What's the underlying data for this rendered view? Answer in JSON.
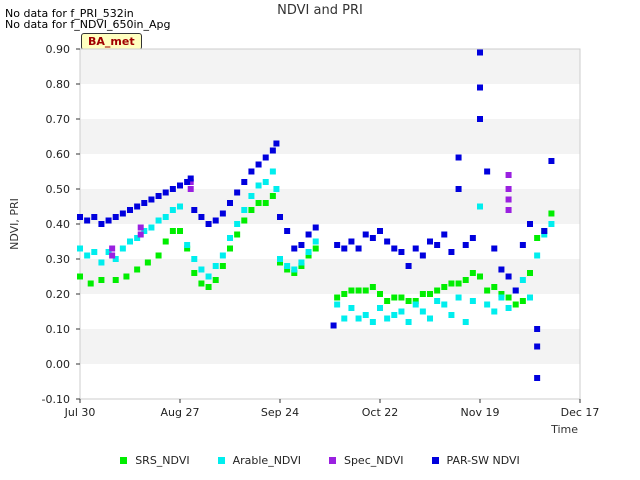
{
  "chart_data": {
    "type": "scatter",
    "title": "NDVI and PRI",
    "xlabel": "Time",
    "ylabel": "NDVI, PRI",
    "notes": [
      "No data for f_PRI_532in",
      "No data for f_NDVI_650in_Apg"
    ],
    "site_label": "BA_met",
    "ylim": [
      -0.1,
      0.9
    ],
    "y_ticks": [
      "-0.10",
      "0.00",
      "0.10",
      "0.20",
      "0.30",
      "0.40",
      "0.50",
      "0.60",
      "0.70",
      "0.80",
      "0.90"
    ],
    "x_ticks": [
      "Jul 30",
      "Aug 27",
      "Sep 24",
      "Oct 22",
      "Nov 19",
      "Dec 17"
    ],
    "grid": "horizontal bands",
    "legend_position": "bottom",
    "series": [
      {
        "name": "SRS_NDVI",
        "color": "#00ee00",
        "points": [
          [
            0,
            0.25
          ],
          [
            3,
            0.23
          ],
          [
            6,
            0.24
          ],
          [
            10,
            0.24
          ],
          [
            13,
            0.25
          ],
          [
            16,
            0.27
          ],
          [
            19,
            0.29
          ],
          [
            22,
            0.31
          ],
          [
            24,
            0.35
          ],
          [
            26,
            0.38
          ],
          [
            28,
            0.38
          ],
          [
            30,
            0.33
          ],
          [
            32,
            0.26
          ],
          [
            34,
            0.23
          ],
          [
            36,
            0.22
          ],
          [
            38,
            0.24
          ],
          [
            40,
            0.28
          ],
          [
            42,
            0.33
          ],
          [
            44,
            0.37
          ],
          [
            46,
            0.41
          ],
          [
            48,
            0.44
          ],
          [
            50,
            0.46
          ],
          [
            52,
            0.46
          ],
          [
            54,
            0.48
          ],
          [
            56,
            0.29
          ],
          [
            58,
            0.27
          ],
          [
            60,
            0.26
          ],
          [
            62,
            0.28
          ],
          [
            64,
            0.31
          ],
          [
            66,
            0.33
          ],
          [
            72,
            0.19
          ],
          [
            74,
            0.2
          ],
          [
            76,
            0.21
          ],
          [
            78,
            0.21
          ],
          [
            80,
            0.21
          ],
          [
            82,
            0.22
          ],
          [
            84,
            0.2
          ],
          [
            86,
            0.18
          ],
          [
            88,
            0.19
          ],
          [
            90,
            0.19
          ],
          [
            92,
            0.18
          ],
          [
            94,
            0.18
          ],
          [
            96,
            0.2
          ],
          [
            98,
            0.2
          ],
          [
            100,
            0.21
          ],
          [
            102,
            0.22
          ],
          [
            104,
            0.23
          ],
          [
            106,
            0.23
          ],
          [
            108,
            0.24
          ],
          [
            110,
            0.26
          ],
          [
            112,
            0.25
          ],
          [
            114,
            0.21
          ],
          [
            116,
            0.22
          ],
          [
            118,
            0.2
          ],
          [
            120,
            0.19
          ],
          [
            122,
            0.17
          ],
          [
            124,
            0.18
          ],
          [
            126,
            0.26
          ],
          [
            128,
            0.36
          ],
          [
            130,
            0.38
          ],
          [
            132,
            0.43
          ]
        ]
      },
      {
        "name": "Arable_NDVI",
        "color": "#00eeee",
        "points": [
          [
            0,
            0.33
          ],
          [
            2,
            0.31
          ],
          [
            4,
            0.32
          ],
          [
            6,
            0.29
          ],
          [
            8,
            0.32
          ],
          [
            10,
            0.3
          ],
          [
            12,
            0.33
          ],
          [
            14,
            0.35
          ],
          [
            16,
            0.36
          ],
          [
            18,
            0.38
          ],
          [
            20,
            0.39
          ],
          [
            22,
            0.41
          ],
          [
            24,
            0.42
          ],
          [
            26,
            0.44
          ],
          [
            28,
            0.45
          ],
          [
            30,
            0.34
          ],
          [
            32,
            0.3
          ],
          [
            34,
            0.27
          ],
          [
            36,
            0.25
          ],
          [
            38,
            0.28
          ],
          [
            40,
            0.31
          ],
          [
            42,
            0.36
          ],
          [
            44,
            0.4
          ],
          [
            46,
            0.44
          ],
          [
            48,
            0.48
          ],
          [
            50,
            0.51
          ],
          [
            52,
            0.52
          ],
          [
            54,
            0.55
          ],
          [
            55,
            0.5
          ],
          [
            56,
            0.3
          ],
          [
            58,
            0.28
          ],
          [
            60,
            0.27
          ],
          [
            62,
            0.29
          ],
          [
            64,
            0.32
          ],
          [
            66,
            0.35
          ],
          [
            72,
            0.17
          ],
          [
            74,
            0.13
          ],
          [
            76,
            0.16
          ],
          [
            78,
            0.13
          ],
          [
            80,
            0.14
          ],
          [
            82,
            0.12
          ],
          [
            84,
            0.16
          ],
          [
            86,
            0.13
          ],
          [
            88,
            0.14
          ],
          [
            90,
            0.15
          ],
          [
            92,
            0.12
          ],
          [
            94,
            0.17
          ],
          [
            96,
            0.15
          ],
          [
            98,
            0.13
          ],
          [
            100,
            0.18
          ],
          [
            102,
            0.17
          ],
          [
            104,
            0.14
          ],
          [
            106,
            0.19
          ],
          [
            108,
            0.12
          ],
          [
            110,
            0.18
          ],
          [
            112,
            0.45
          ],
          [
            114,
            0.17
          ],
          [
            116,
            0.15
          ],
          [
            118,
            0.19
          ],
          [
            120,
            0.16
          ],
          [
            122,
            0.21
          ],
          [
            124,
            0.24
          ],
          [
            126,
            0.19
          ],
          [
            128,
            0.31
          ],
          [
            130,
            0.37
          ],
          [
            132,
            0.4
          ]
        ]
      },
      {
        "name": "Spec_NDVI",
        "color": "#9a20e0",
        "points": [
          [
            9,
            0.31
          ],
          [
            9,
            0.33
          ],
          [
            17,
            0.37
          ],
          [
            17,
            0.39
          ],
          [
            31,
            0.5
          ],
          [
            31,
            0.52
          ],
          [
            120,
            0.54
          ],
          [
            120,
            0.5
          ],
          [
            120,
            0.47
          ],
          [
            120,
            0.44
          ]
        ]
      },
      {
        "name": "PAR-SW NDVI",
        "color": "#0000dd",
        "points": [
          [
            0,
            0.42
          ],
          [
            2,
            0.41
          ],
          [
            4,
            0.42
          ],
          [
            6,
            0.4
          ],
          [
            8,
            0.41
          ],
          [
            10,
            0.42
          ],
          [
            12,
            0.43
          ],
          [
            14,
            0.44
          ],
          [
            16,
            0.45
          ],
          [
            18,
            0.46
          ],
          [
            20,
            0.47
          ],
          [
            22,
            0.48
          ],
          [
            24,
            0.49
          ],
          [
            26,
            0.5
          ],
          [
            28,
            0.51
          ],
          [
            30,
            0.52
          ],
          [
            31,
            0.53
          ],
          [
            32,
            0.44
          ],
          [
            34,
            0.42
          ],
          [
            36,
            0.4
          ],
          [
            38,
            0.41
          ],
          [
            40,
            0.43
          ],
          [
            42,
            0.46
          ],
          [
            44,
            0.49
          ],
          [
            46,
            0.52
          ],
          [
            48,
            0.55
          ],
          [
            50,
            0.57
          ],
          [
            52,
            0.59
          ],
          [
            54,
            0.61
          ],
          [
            55,
            0.63
          ],
          [
            56,
            0.42
          ],
          [
            58,
            0.38
          ],
          [
            60,
            0.33
          ],
          [
            62,
            0.34
          ],
          [
            64,
            0.37
          ],
          [
            66,
            0.39
          ],
          [
            71,
            0.11
          ],
          [
            72,
            0.34
          ],
          [
            74,
            0.33
          ],
          [
            76,
            0.35
          ],
          [
            78,
            0.33
          ],
          [
            80,
            0.37
          ],
          [
            82,
            0.36
          ],
          [
            84,
            0.38
          ],
          [
            86,
            0.35
          ],
          [
            88,
            0.33
          ],
          [
            90,
            0.32
          ],
          [
            92,
            0.28
          ],
          [
            94,
            0.33
          ],
          [
            96,
            0.31
          ],
          [
            98,
            0.35
          ],
          [
            100,
            0.34
          ],
          [
            102,
            0.37
          ],
          [
            104,
            0.32
          ],
          [
            106,
            0.59
          ],
          [
            106,
            0.5
          ],
          [
            108,
            0.34
          ],
          [
            110,
            0.36
          ],
          [
            112,
            0.89
          ],
          [
            112,
            0.79
          ],
          [
            112,
            0.7
          ],
          [
            114,
            0.55
          ],
          [
            116,
            0.33
          ],
          [
            118,
            0.27
          ],
          [
            120,
            0.25
          ],
          [
            122,
            0.21
          ],
          [
            124,
            0.34
          ],
          [
            126,
            0.4
          ],
          [
            128,
            0.1
          ],
          [
            128,
            0.05
          ],
          [
            128,
            -0.04
          ],
          [
            130,
            0.38
          ],
          [
            132,
            0.58
          ]
        ]
      }
    ]
  }
}
